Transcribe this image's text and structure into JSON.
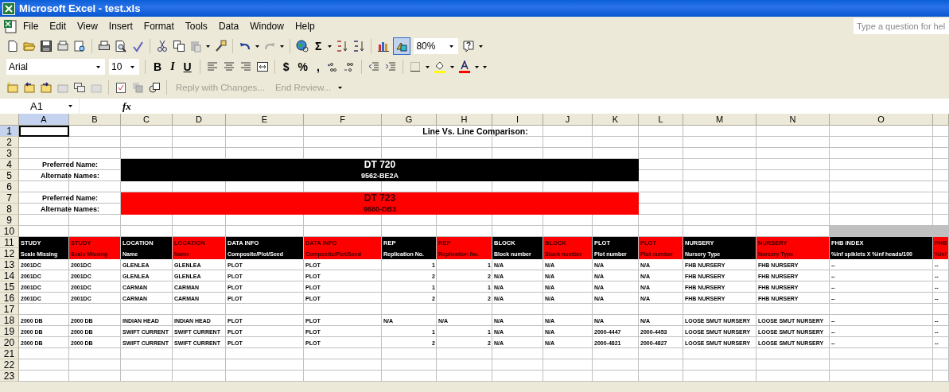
{
  "window": {
    "title": "Microsoft Excel - test.xls"
  },
  "menu": [
    "File",
    "Edit",
    "View",
    "Insert",
    "Format",
    "Tools",
    "Data",
    "Window",
    "Help"
  ],
  "help_box": {
    "placeholder": "Type a question for hel"
  },
  "standard_toolbar": {
    "autosum": "Σ",
    "zoom": "80%",
    "drawing": {
      "pressed": true
    }
  },
  "formatting_toolbar": {
    "font": "Arial",
    "size": "10",
    "bold": "B",
    "italic": "I",
    "underline": "U",
    "currency": "$",
    "percent": "%",
    "comma": ","
  },
  "reviewing_toolbar": [
    {
      "label": "Reply with Changes...",
      "disabled": true
    },
    {
      "label": "End Review...",
      "disabled": true
    }
  ],
  "formula_bar": {
    "name_box": "A1",
    "fx": "fx"
  },
  "sheet": {
    "columns": [
      {
        "label": "A",
        "selected": true
      },
      {
        "label": "B",
        "selected": false
      },
      {
        "label": "C",
        "selected": false
      },
      {
        "label": "D",
        "selected": false
      },
      {
        "label": "E",
        "selected": false
      },
      {
        "label": "F",
        "selected": false
      },
      {
        "label": "G",
        "selected": false
      },
      {
        "label": "H",
        "selected": false
      },
      {
        "label": "I",
        "selected": false
      },
      {
        "label": "J",
        "selected": false
      },
      {
        "label": "K",
        "selected": false
      },
      {
        "label": "L",
        "selected": false
      },
      {
        "label": "M",
        "selected": false
      },
      {
        "label": "N",
        "selected": false
      },
      {
        "label": "O",
        "selected": false
      }
    ],
    "title": "Line Vs. Line Comparison:",
    "lines": [
      {
        "preferred_label": "Preferred Name:",
        "preferred": "DT 720",
        "alternate_label": "Alternate Names:",
        "alternate": "9562-BE2A",
        "color": "#000000"
      },
      {
        "preferred_label": "Preferred Name:",
        "preferred": "DT 723",
        "alternate_label": "Alternate Names:",
        "alternate": "9680-DB3",
        "color": "#ff0000"
      }
    ],
    "headers": [
      {
        "title": "STUDY",
        "subtitle": "Scale Missing",
        "color": "#000000"
      },
      {
        "title": "STUDY",
        "subtitle": "Scale Missing",
        "color": "#ff0000"
      },
      {
        "title": "LOCATION",
        "subtitle": "Name",
        "color": "#000000"
      },
      {
        "title": "LOCATION",
        "subtitle": "Name",
        "color": "#ff0000"
      },
      {
        "title": "DATA INFO",
        "subtitle": "Composite/Plot/Seed",
        "color": "#000000"
      },
      {
        "title": "DATA INFO",
        "subtitle": "Composite/Plot/Seed",
        "color": "#ff0000"
      },
      {
        "title": "REP",
        "subtitle": "Replication No.",
        "color": "#000000"
      },
      {
        "title": "REP",
        "subtitle": "Replication No.",
        "color": "#ff0000"
      },
      {
        "title": "BLOCK",
        "subtitle": "Block number",
        "color": "#000000"
      },
      {
        "title": "BLOCK",
        "subtitle": "Block number",
        "color": "#ff0000"
      },
      {
        "title": "PLOT",
        "subtitle": "Plot number",
        "color": "#000000"
      },
      {
        "title": "PLOT",
        "subtitle": "Plot number",
        "color": "#ff0000"
      },
      {
        "title": "NURSERY",
        "subtitle": "Nursery Type",
        "color": "#000000"
      },
      {
        "title": "NURSERY",
        "subtitle": "Nursery Type",
        "color": "#ff0000"
      },
      {
        "title": "FHB INDEX",
        "subtitle": "%inf spiklets X %inf heads/100",
        "color": "#000000"
      },
      {
        "title": "FHB",
        "subtitle": "%inf",
        "color": "#ff0000"
      }
    ],
    "rows": [
      {
        "label": "1",
        "selected": true
      },
      {
        "label": "2",
        "selected": false
      },
      {
        "label": "3",
        "selected": false
      },
      {
        "label": "4",
        "selected": false
      },
      {
        "label": "5",
        "selected": false
      },
      {
        "label": "6",
        "selected": false
      },
      {
        "label": "7",
        "selected": false
      },
      {
        "label": "8",
        "selected": false
      },
      {
        "label": "9",
        "selected": false
      },
      {
        "label": "10",
        "selected": false
      },
      {
        "label": "11",
        "selected": false
      },
      {
        "label": "12",
        "selected": false
      },
      {
        "label": "13",
        "selected": false,
        "cells": [
          "2001DC",
          "2001DC",
          "GLENLEA",
          "GLENLEA",
          "PLOT",
          "PLOT",
          "1",
          "1",
          "N/A",
          "N/A",
          "N/A",
          "N/A",
          "FHB NURSERY",
          "FHB NURSERY",
          "--",
          "--"
        ]
      },
      {
        "label": "14",
        "selected": false,
        "cells": [
          "2001DC",
          "2001DC",
          "GLENLEA",
          "GLENLEA",
          "PLOT",
          "PLOT",
          "2",
          "2",
          "N/A",
          "N/A",
          "N/A",
          "N/A",
          "FHB NURSERY",
          "FHB NURSERY",
          "--",
          "--"
        ]
      },
      {
        "label": "15",
        "selected": false,
        "cells": [
          "2001DC",
          "2001DC",
          "CARMAN",
          "CARMAN",
          "PLOT",
          "PLOT",
          "1",
          "1",
          "N/A",
          "N/A",
          "N/A",
          "N/A",
          "FHB NURSERY",
          "FHB NURSERY",
          "--",
          "--"
        ]
      },
      {
        "label": "16",
        "selected": false,
        "cells": [
          "2001DC",
          "2001DC",
          "CARMAN",
          "CARMAN",
          "PLOT",
          "PLOT",
          "2",
          "2",
          "N/A",
          "N/A",
          "N/A",
          "N/A",
          "FHB NURSERY",
          "FHB NURSERY",
          "--",
          "--"
        ]
      },
      {
        "label": "17",
        "selected": false
      },
      {
        "label": "18",
        "selected": false,
        "cells": [
          "2000 DB",
          "2000 DB",
          "INDIAN HEAD",
          "INDIAN HEAD",
          "PLOT",
          "PLOT",
          "N/A",
          "N/A",
          "N/A",
          "N/A",
          "N/A",
          "N/A",
          "LOOSE SMUT NURSERY",
          "LOOSE SMUT NURSERY",
          "--",
          "--"
        ]
      },
      {
        "label": "19",
        "selected": false,
        "cells": [
          "2000 DB",
          "2000 DB",
          "SWIFT CURRENT",
          "SWIFT CURRENT",
          "PLOT",
          "PLOT",
          "1",
          "1",
          "N/A",
          "N/A",
          "2000-4447",
          "2000-4453",
          "LOOSE SMUT NURSERY",
          "LOOSE SMUT NURSERY",
          "--",
          "--"
        ]
      },
      {
        "label": "20",
        "selected": false,
        "cells": [
          "2000 DB",
          "2000 DB",
          "SWIFT CURRENT",
          "SWIFT CURRENT",
          "PLOT",
          "PLOT",
          "2",
          "2",
          "N/A",
          "N/A",
          "2000-4821",
          "2000-4827",
          "LOOSE SMUT NURSERY",
          "LOOSE SMUT NURSERY",
          "--",
          "--"
        ]
      },
      {
        "label": "21",
        "selected": false
      },
      {
        "label": "22",
        "selected": false
      },
      {
        "label": "23",
        "selected": false
      }
    ]
  }
}
